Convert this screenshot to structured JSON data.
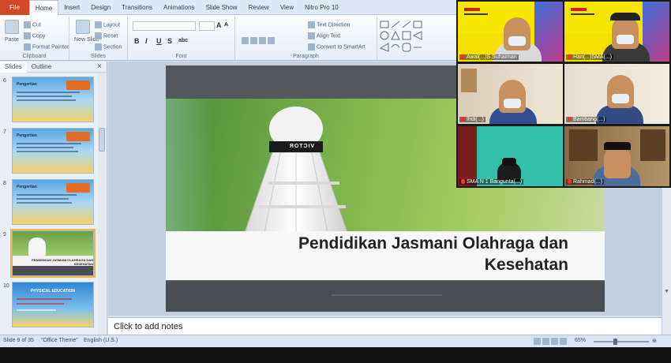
{
  "ribbon": {
    "tabs": [
      "File",
      "Home",
      "Insert",
      "Design",
      "Transitions",
      "Animations",
      "Slide Show",
      "Review",
      "View",
      "Nitro Pro 10"
    ],
    "active_tab": "Home",
    "clipboard": {
      "paste": "Paste",
      "cut": "Cut",
      "copy": "Copy",
      "format_painter": "Format Painter",
      "label": "Clipboard"
    },
    "slides": {
      "new_slide": "New Slide",
      "layout": "Layout",
      "reset": "Reset",
      "section": "Section",
      "label": "Slides"
    },
    "font": {
      "bold": "B",
      "italic": "I",
      "underline": "U",
      "strike": "S",
      "shadow": "abc",
      "grow": "A",
      "shrink": "A",
      "label": "Font"
    },
    "paragraph": {
      "text_direction": "Text Direction",
      "align_text": "Align Text",
      "convert_smartart": "Convert to SmartArt",
      "label": "Paragraph"
    }
  },
  "panel": {
    "tab_slides": "Slides",
    "tab_outline": "Outline",
    "close": "×",
    "thumbs": [
      {
        "num": "6",
        "title": "Pengertian"
      },
      {
        "num": "7",
        "title": "Pengertian"
      },
      {
        "num": "8",
        "title": "Pengertian"
      },
      {
        "num": "9",
        "title": "PENDIDIKAN JASMANI OLAHRAGA DAN KESEHATAN",
        "selected": true
      },
      {
        "num": "10",
        "title": "PHYSICAL EDUCATION"
      }
    ]
  },
  "slide": {
    "title_line1": "Pendidikan Jasmani Olahraga dan",
    "title_line2": "Kesehatan",
    "shuttle_brand": "VICTOR"
  },
  "notes": {
    "placeholder": "Click to add notes"
  },
  "status": {
    "slide_info": "Slide 9 of 35",
    "theme": "\"Office Theme\"",
    "language": "English (U.S.)",
    "zoom": "65%"
  },
  "video": {
    "participants": [
      {
        "name": "Awal(...)S.Suhaiman",
        "banner": true,
        "mask": true
      },
      {
        "name": "Hari(...)SMA(...)",
        "banner": true,
        "mask": true
      },
      {
        "name": "Ihdi(...)",
        "banner": false,
        "mask": true
      },
      {
        "name": "Bambang(...)",
        "banner": false,
        "mask": true
      },
      {
        "name": "SMA N 1 Bangunta(...)",
        "banner": false,
        "mask": false
      },
      {
        "name": "Rahmad(...)",
        "banner": false,
        "mask": false
      }
    ]
  }
}
